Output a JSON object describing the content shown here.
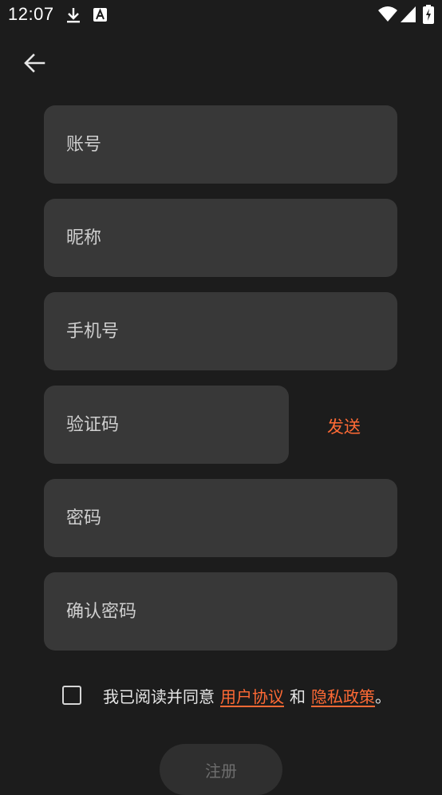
{
  "status_bar": {
    "time": "12:07",
    "icons_left": [
      "download-icon",
      "font-a-icon"
    ],
    "icons_right": [
      "wifi-icon",
      "signal-icon",
      "battery-charging-icon"
    ]
  },
  "nav": {
    "back_icon": "arrow-left-icon"
  },
  "form": {
    "account_placeholder": "账号",
    "nickname_placeholder": "昵称",
    "phone_placeholder": "手机号",
    "code_placeholder": "验证码",
    "send_label": "发送",
    "password_placeholder": "密码",
    "confirm_password_placeholder": "确认密码"
  },
  "agreement": {
    "checked": false,
    "prefix": "我已阅读并同意",
    "user_agreement": "用户协议",
    "and": "和",
    "privacy_policy": "隐私政策",
    "suffix": "。"
  },
  "register_label": "注册",
  "colors": {
    "background": "#1c1c1c",
    "field": "#383838",
    "accent": "#ff6a35",
    "disabled_text": "#6e6e6e"
  }
}
